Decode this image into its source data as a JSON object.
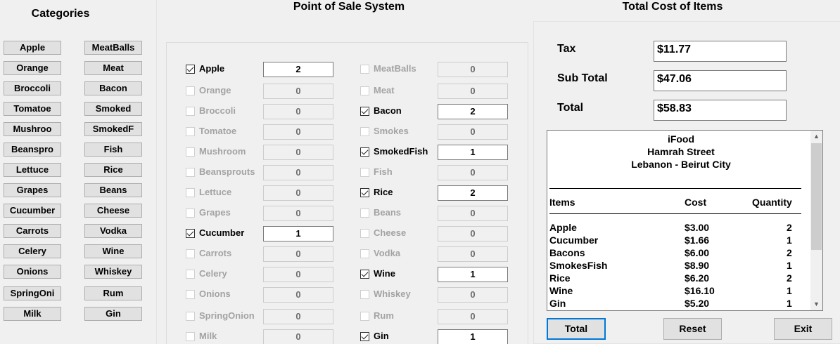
{
  "categories": {
    "heading": "Categories",
    "left": [
      "Apple",
      "Orange",
      "Broccoli",
      "Tomatoe",
      "Mushroo",
      "Beanspro",
      "Lettuce",
      "Grapes",
      "Cucumber",
      "Carrots",
      "Celery",
      "Onions",
      "SpringOni",
      "Milk"
    ],
    "right": [
      "MeatBalls",
      "Meat",
      "Bacon",
      "Smoked",
      "SmokedF",
      "Fish",
      "Rice",
      "Beans",
      "Cheese",
      "Vodka",
      "Wine",
      "Whiskey",
      "Rum",
      "Gin"
    ]
  },
  "pos": {
    "heading": "Point of Sale System",
    "left_items": [
      {
        "label": "Apple",
        "checked": true,
        "qty": "2"
      },
      {
        "label": "Orange",
        "checked": false,
        "qty": "0"
      },
      {
        "label": "Broccoli",
        "checked": false,
        "qty": "0"
      },
      {
        "label": "Tomatoe",
        "checked": false,
        "qty": "0"
      },
      {
        "label": "Mushroom",
        "checked": false,
        "qty": "0"
      },
      {
        "label": "Beansprouts",
        "checked": false,
        "qty": "0"
      },
      {
        "label": "Lettuce",
        "checked": false,
        "qty": "0"
      },
      {
        "label": "Grapes",
        "checked": false,
        "qty": "0"
      },
      {
        "label": "Cucumber",
        "checked": true,
        "qty": "1"
      },
      {
        "label": "Carrots",
        "checked": false,
        "qty": "0"
      },
      {
        "label": "Celery",
        "checked": false,
        "qty": "0"
      },
      {
        "label": "Onions",
        "checked": false,
        "qty": "0"
      },
      {
        "label": "SpringOnion",
        "checked": false,
        "qty": "0"
      },
      {
        "label": "Milk",
        "checked": false,
        "qty": "0"
      }
    ],
    "right_items": [
      {
        "label": "MeatBalls",
        "checked": false,
        "qty": "0"
      },
      {
        "label": "Meat",
        "checked": false,
        "qty": "0"
      },
      {
        "label": "Bacon",
        "checked": true,
        "qty": "2"
      },
      {
        "label": "Smokes",
        "checked": false,
        "qty": "0"
      },
      {
        "label": "SmokedFish",
        "checked": true,
        "qty": "1"
      },
      {
        "label": "Fish",
        "checked": false,
        "qty": "0"
      },
      {
        "label": "Rice",
        "checked": true,
        "qty": "2"
      },
      {
        "label": "Beans",
        "checked": false,
        "qty": "0"
      },
      {
        "label": "Cheese",
        "checked": false,
        "qty": "0"
      },
      {
        "label": "Vodka",
        "checked": false,
        "qty": "0"
      },
      {
        "label": "Wine",
        "checked": true,
        "qty": "1"
      },
      {
        "label": "Whiskey",
        "checked": false,
        "qty": "0"
      },
      {
        "label": "Rum",
        "checked": false,
        "qty": "0"
      },
      {
        "label": "Gin",
        "checked": true,
        "qty": "1"
      }
    ]
  },
  "totals": {
    "heading": "Total Cost of Items",
    "tax_label": "Tax",
    "tax_value": "$11.77",
    "subtotal_label": "Sub Total",
    "subtotal_value": "$47.06",
    "total_label": "Total",
    "total_value": "$58.83"
  },
  "receipt": {
    "store": "iFood",
    "street": "Hamrah Street",
    "city": "Lebanon - Beirut City",
    "col_items": "Items",
    "col_cost": "Cost",
    "col_qty": "Quantity",
    "lines": [
      {
        "item": "Apple",
        "cost": "$3.00",
        "qty": "2"
      },
      {
        "item": "Cucumber",
        "cost": "$1.66",
        "qty": "1"
      },
      {
        "item": "Bacons",
        "cost": "$6.00",
        "qty": "2"
      },
      {
        "item": "SmokesFish",
        "cost": "$8.90",
        "qty": "1"
      },
      {
        "item": "Rice",
        "cost": "$6.20",
        "qty": "2"
      },
      {
        "item": "Wine",
        "cost": "$16.10",
        "qty": "1"
      },
      {
        "item": "Gin",
        "cost": "$5.20",
        "qty": "1"
      }
    ]
  },
  "buttons": {
    "total": "Total",
    "reset": "Reset",
    "exit": "Exit"
  },
  "icons": {
    "scroll_up": "chevron-up-icon",
    "scroll_down": "chevron-down-icon"
  }
}
